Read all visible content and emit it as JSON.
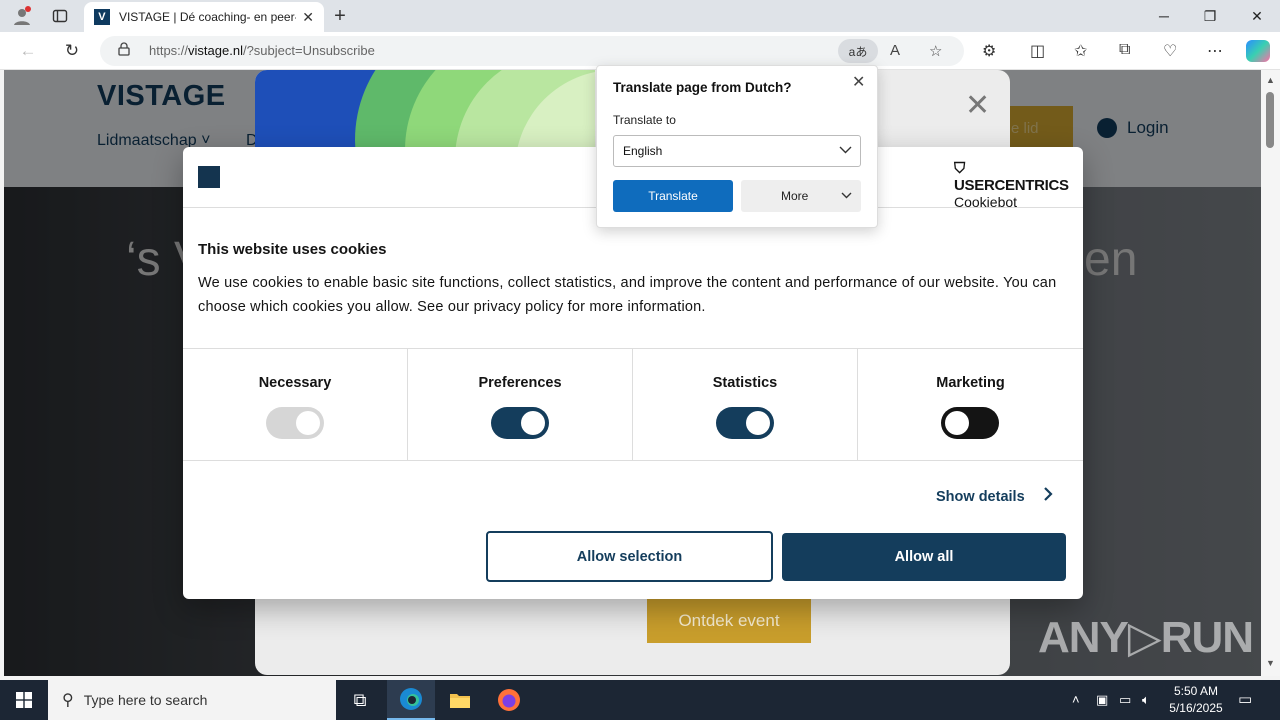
{
  "browser": {
    "tab_title": "VISTAGE | Dé coaching- en peer-adviesorganisatie",
    "tab_favicon": "V",
    "url_prefix": "https://",
    "url_domain": "vistage.nl",
    "url_rest": "/?subject=Unsubscribe",
    "translate_icon_label": "aあ"
  },
  "site": {
    "logo": "VISTAGE",
    "menu_item_1": "Lidmaatschap",
    "menu_item_2": "D",
    "cta_partial": "e lid",
    "login": "Login",
    "hero_left": "‘s V",
    "hero_right": "en"
  },
  "event_modal": {
    "button": "Ontdek event"
  },
  "cookie": {
    "brand_title": "USERCENTRICS",
    "brand_sub": "Cookiebot",
    "title": "This website uses cookies",
    "text": "We use cookies to enable basic site functions, collect statistics, and improve the content and performance of our website. You can choose which cookies you allow. See our privacy policy for more information.",
    "categories": [
      {
        "label": "Necessary",
        "state": "disabled"
      },
      {
        "label": "Preferences",
        "state": "on"
      },
      {
        "label": "Statistics",
        "state": "on"
      },
      {
        "label": "Marketing",
        "state": "off"
      }
    ],
    "show_details": "Show details",
    "allow_selection": "Allow selection",
    "allow_all": "Allow all"
  },
  "translate": {
    "title": "Translate page from Dutch?",
    "to_label": "Translate to",
    "language": "English",
    "translate_button": "Translate",
    "more_button": "More"
  },
  "watermark": "ANY▷RUN",
  "taskbar": {
    "search_placeholder": "Type here to search",
    "time": "5:50 AM",
    "date": "5/16/2025"
  },
  "colors": {
    "brand_navy": "#143d5c",
    "gold": "#c99e2c",
    "translate_blue": "#0f6cbd"
  }
}
